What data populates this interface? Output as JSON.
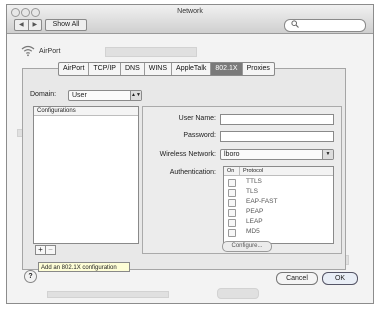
{
  "window": {
    "title": "Network",
    "show_all": "Show All",
    "nav_back": "◀",
    "nav_forward": "▶",
    "search_icon": "search-icon"
  },
  "service": {
    "name": "AirPort"
  },
  "tabs": [
    {
      "label": "AirPort"
    },
    {
      "label": "TCP/IP"
    },
    {
      "label": "DNS"
    },
    {
      "label": "WINS"
    },
    {
      "label": "AppleTalk"
    },
    {
      "label": "802.1X",
      "active": true
    },
    {
      "label": "Proxies"
    }
  ],
  "domain": {
    "label": "Domain:",
    "value": "User"
  },
  "configurations": {
    "header": "Configurations",
    "add": "+",
    "remove": "−"
  },
  "tooltip": "Add an 802.1X configuration",
  "form": {
    "user_name_label": "User Name:",
    "user_name_value": "",
    "password_label": "Password:",
    "password_value": "",
    "wireless_network_label": "Wireless Network:",
    "wireless_network_value": "lboro",
    "authentication_label": "Authentication:"
  },
  "auth_table": {
    "col_on": "On",
    "col_protocol": "Protocol",
    "rows": [
      {
        "protocol": "TTLS",
        "on": false
      },
      {
        "protocol": "TLS",
        "on": false
      },
      {
        "protocol": "EAP-FAST",
        "on": false
      },
      {
        "protocol": "PEAP",
        "on": false
      },
      {
        "protocol": "LEAP",
        "on": false
      },
      {
        "protocol": "MD5",
        "on": false
      }
    ]
  },
  "configure_button": "Configure...",
  "help": "?",
  "cancel_button": "Cancel",
  "ok_button": "OK"
}
